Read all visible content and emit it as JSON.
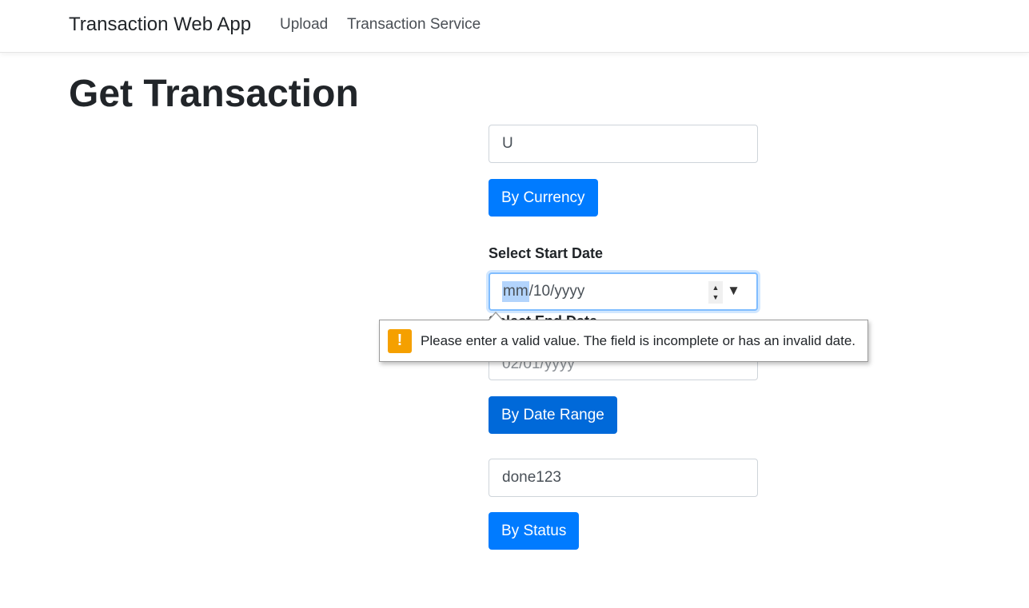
{
  "navbar": {
    "brand": "Transaction Web App",
    "links": [
      "Upload",
      "Transaction Service"
    ]
  },
  "page": {
    "title": "Get Transaction"
  },
  "currency": {
    "value": "U",
    "button": "By Currency"
  },
  "date_range": {
    "start_label": "Select Start Date",
    "start_value_mm": "mm",
    "start_value_rest": "/10/yyyy",
    "end_label": "Select End Date",
    "end_value": "02/01/yyyy",
    "button": "By Date Range"
  },
  "validation": {
    "icon": "warning-icon",
    "message": "Please enter a valid value. The field is incomplete or has an invalid date."
  },
  "status": {
    "value": "done123",
    "button": "By Status"
  },
  "colors": {
    "primary": "#007bff",
    "focus_border": "#80bdff",
    "warning": "#f5a000"
  }
}
